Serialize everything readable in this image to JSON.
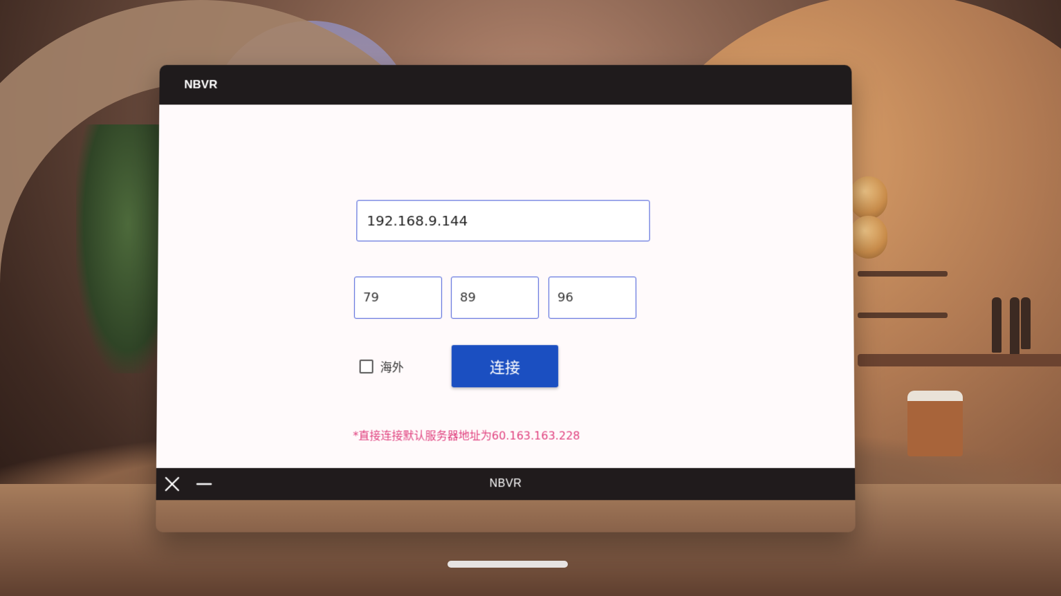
{
  "window": {
    "title": "NBVR",
    "bottom_title": "NBVR"
  },
  "form": {
    "server_ip": "192.168.9.144",
    "fields": [
      "79",
      "89",
      "96"
    ],
    "overseas_label": "海外",
    "overseas_checked": false,
    "connect_label": "连接",
    "hint": "*直接连接默认服务器地址为60.163.163.228"
  },
  "bottombar": {
    "close_icon": "close-icon",
    "minimize_icon": "minimize-icon"
  },
  "colors": {
    "primary_button": "#1b4fc1",
    "input_border": "#3d54d6",
    "hint_text": "#e0427f",
    "titlebar": "#1f1b1c"
  }
}
